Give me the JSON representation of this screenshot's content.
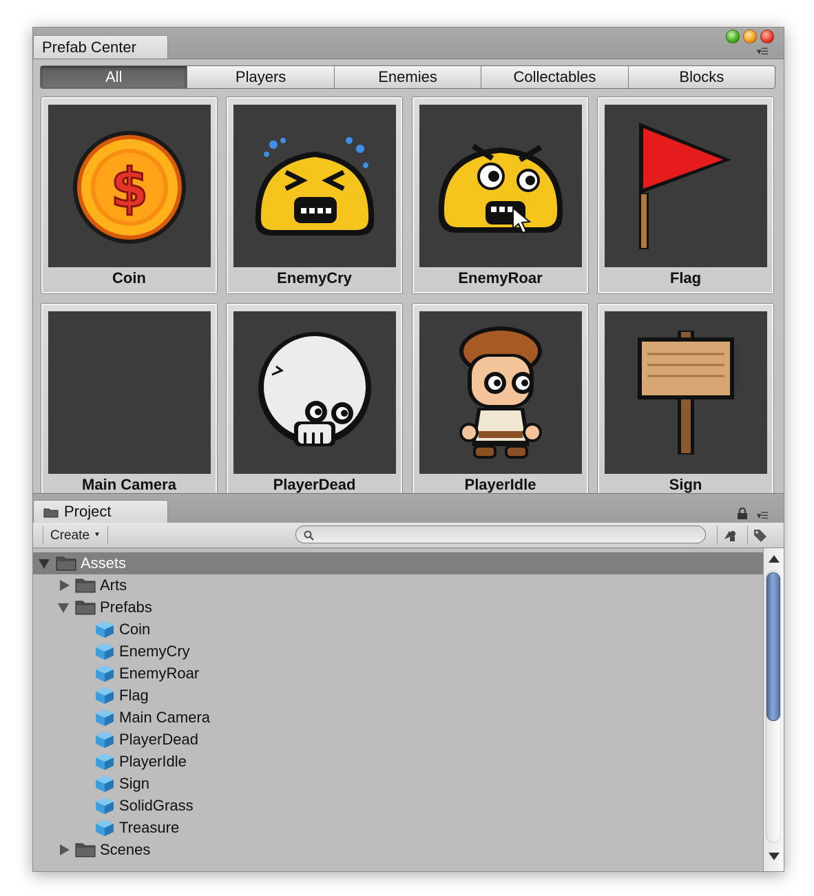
{
  "prefab_center": {
    "title": "Prefab Center",
    "categories": [
      {
        "label": "All",
        "active": true
      },
      {
        "label": "Players",
        "active": false
      },
      {
        "label": "Enemies",
        "active": false
      },
      {
        "label": "Collectables",
        "active": false
      },
      {
        "label": "Blocks",
        "active": false
      }
    ],
    "prefabs": [
      {
        "label": "Coin",
        "icon": "coin-icon"
      },
      {
        "label": "EnemyCry",
        "icon": "enemy-cry-icon"
      },
      {
        "label": "EnemyRoar",
        "icon": "enemy-roar-icon"
      },
      {
        "label": "Flag",
        "icon": "flag-icon"
      },
      {
        "label": "Main Camera",
        "icon": ""
      },
      {
        "label": "PlayerDead",
        "icon": "skull-icon"
      },
      {
        "label": "PlayerIdle",
        "icon": "player-idle-icon"
      },
      {
        "label": "Sign",
        "icon": "sign-icon"
      }
    ]
  },
  "project": {
    "title": "Project",
    "create_label": "Create",
    "search": {
      "placeholder": "",
      "value": ""
    },
    "tree": [
      {
        "label": "Assets",
        "type": "folder",
        "depth": 0,
        "expanded": true,
        "selected": true
      },
      {
        "label": "Arts",
        "type": "folder",
        "depth": 1,
        "expanded": false,
        "selected": false
      },
      {
        "label": "Prefabs",
        "type": "folder",
        "depth": 1,
        "expanded": true,
        "selected": false
      },
      {
        "label": "Coin",
        "type": "prefab",
        "depth": 2
      },
      {
        "label": "EnemyCry",
        "type": "prefab",
        "depth": 2
      },
      {
        "label": "EnemyRoar",
        "type": "prefab",
        "depth": 2
      },
      {
        "label": "Flag",
        "type": "prefab",
        "depth": 2
      },
      {
        "label": "Main Camera",
        "type": "prefab",
        "depth": 2
      },
      {
        "label": "PlayerDead",
        "type": "prefab",
        "depth": 2
      },
      {
        "label": "PlayerIdle",
        "type": "prefab",
        "depth": 2
      },
      {
        "label": "Sign",
        "type": "prefab",
        "depth": 2
      },
      {
        "label": "SolidGrass",
        "type": "prefab",
        "depth": 2
      },
      {
        "label": "Treasure",
        "type": "prefab",
        "depth": 2
      },
      {
        "label": "Scenes",
        "type": "folder",
        "depth": 1,
        "expanded": false,
        "selected": false
      }
    ]
  },
  "colors": {
    "selection": "#7f7f7f",
    "thumb_bg": "#3c3c3c",
    "accent_scroll": "#6f8dbd"
  }
}
